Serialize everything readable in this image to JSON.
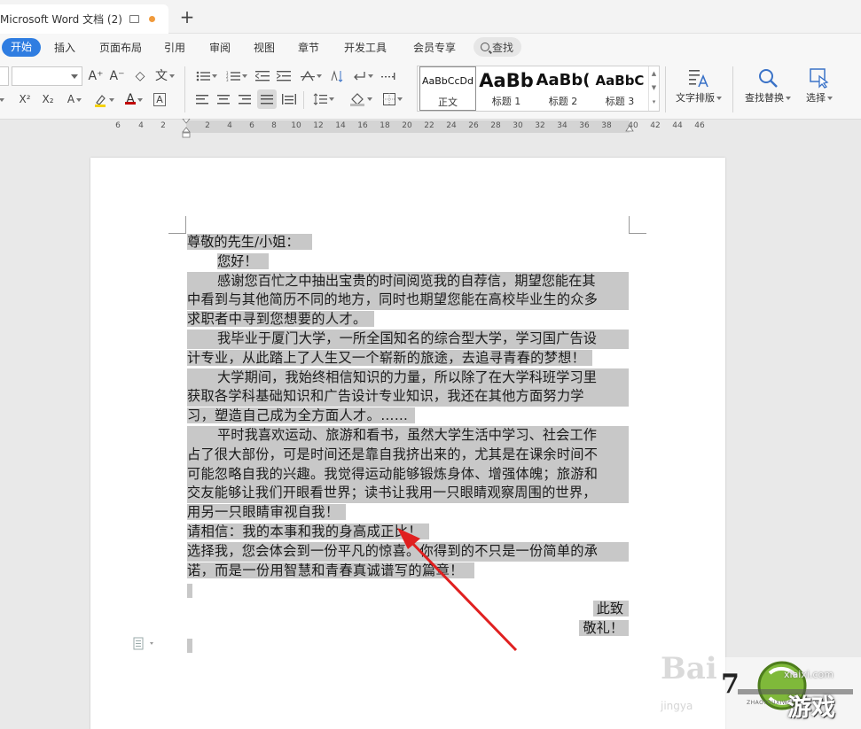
{
  "titlebar": {
    "doc_title": "Microsoft Word 文档 (2)",
    "new_tab": "+"
  },
  "menu": {
    "items": [
      "开始",
      "插入",
      "页面布局",
      "引用",
      "审阅",
      "视图",
      "章节",
      "开发工具",
      "会员专享"
    ],
    "active": "开始",
    "search_label": "查找"
  },
  "ribbon": {
    "grow_font": "A⁺",
    "shrink_font": "A⁻",
    "clear_format": "◇",
    "phonetic": "文",
    "superscript": "X²",
    "subscript": "X₂",
    "font_color_letter": "A",
    "char_border": "A",
    "styles": [
      {
        "preview": "AaBbCcDd",
        "name": "正文"
      },
      {
        "preview": "AaBb",
        "name": "标题 1"
      },
      {
        "preview": "AaBb(",
        "name": "标题 2"
      },
      {
        "preview": "AaBbC",
        "name": "标题 3"
      }
    ],
    "text_layout_label": "文字排版",
    "find_replace_label": "查找替换",
    "select_label": "选择"
  },
  "ruler": {
    "left_ticks": [
      "6",
      "4",
      "2"
    ],
    "right_ticks": [
      "2",
      "4",
      "6",
      "8",
      "10",
      "12",
      "14",
      "16",
      "18",
      "20",
      "22",
      "24",
      "26",
      "28",
      "30",
      "32",
      "34",
      "36",
      "38"
    ],
    "outer_ticks": [
      "40",
      "42",
      "44",
      "46"
    ]
  },
  "document": {
    "lines": [
      "尊敬的先生/小姐：",
      "您好！",
      "感谢您百忙之中抽出宝贵的时间阅览我的自荐信，期望您能在其",
      "中看到与其他简历不同的地方，同时也期望您能在高校毕业生的众多",
      "求职者中寻到您想要的人才。",
      "我毕业于厦门大学，一所全国知名的综合型大学，学习国广告设",
      "计专业，从此踏上了人生又一个崭新的旅途，去追寻青春的梦想！",
      "大学期间，我始终相信知识的力量，所以除了在大学科班学习里",
      "获取各学科基础知识和广告设计专业知识，我还在其他方面努力学",
      "习，塑造自己成为全方面人才。……",
      "平时我喜欢运动、旅游和看书，虽然大学生活中学习、社会工作",
      "占了很大部份，可是时间还是靠自我挤出来的，尤其是在课余时间不",
      "可能忽略自我的兴趣。我觉得运动能够锻炼身体、增强体魄；旅游和",
      "交友能够让我们开眼看世界；读书让我用一只眼睛观察周围的世界，",
      "用另一只眼睛审视自我！",
      "请相信：我的本事和我的身高成正比！",
      "选择我，您会体会到一份平凡的惊喜。你得到的不只是一份简单的承",
      "诺，而是一份用智慧和青春真诚谱写的篇章！",
      "此致",
      "敬礼！"
    ]
  },
  "watermark": {
    "bai": "Bai",
    "jing": "jingya",
    "site": "xlaixi.com",
    "brand_prefix": "7",
    "brand_sub": "ZHAOYOUXIWANG",
    "brand_game": "游戏"
  }
}
